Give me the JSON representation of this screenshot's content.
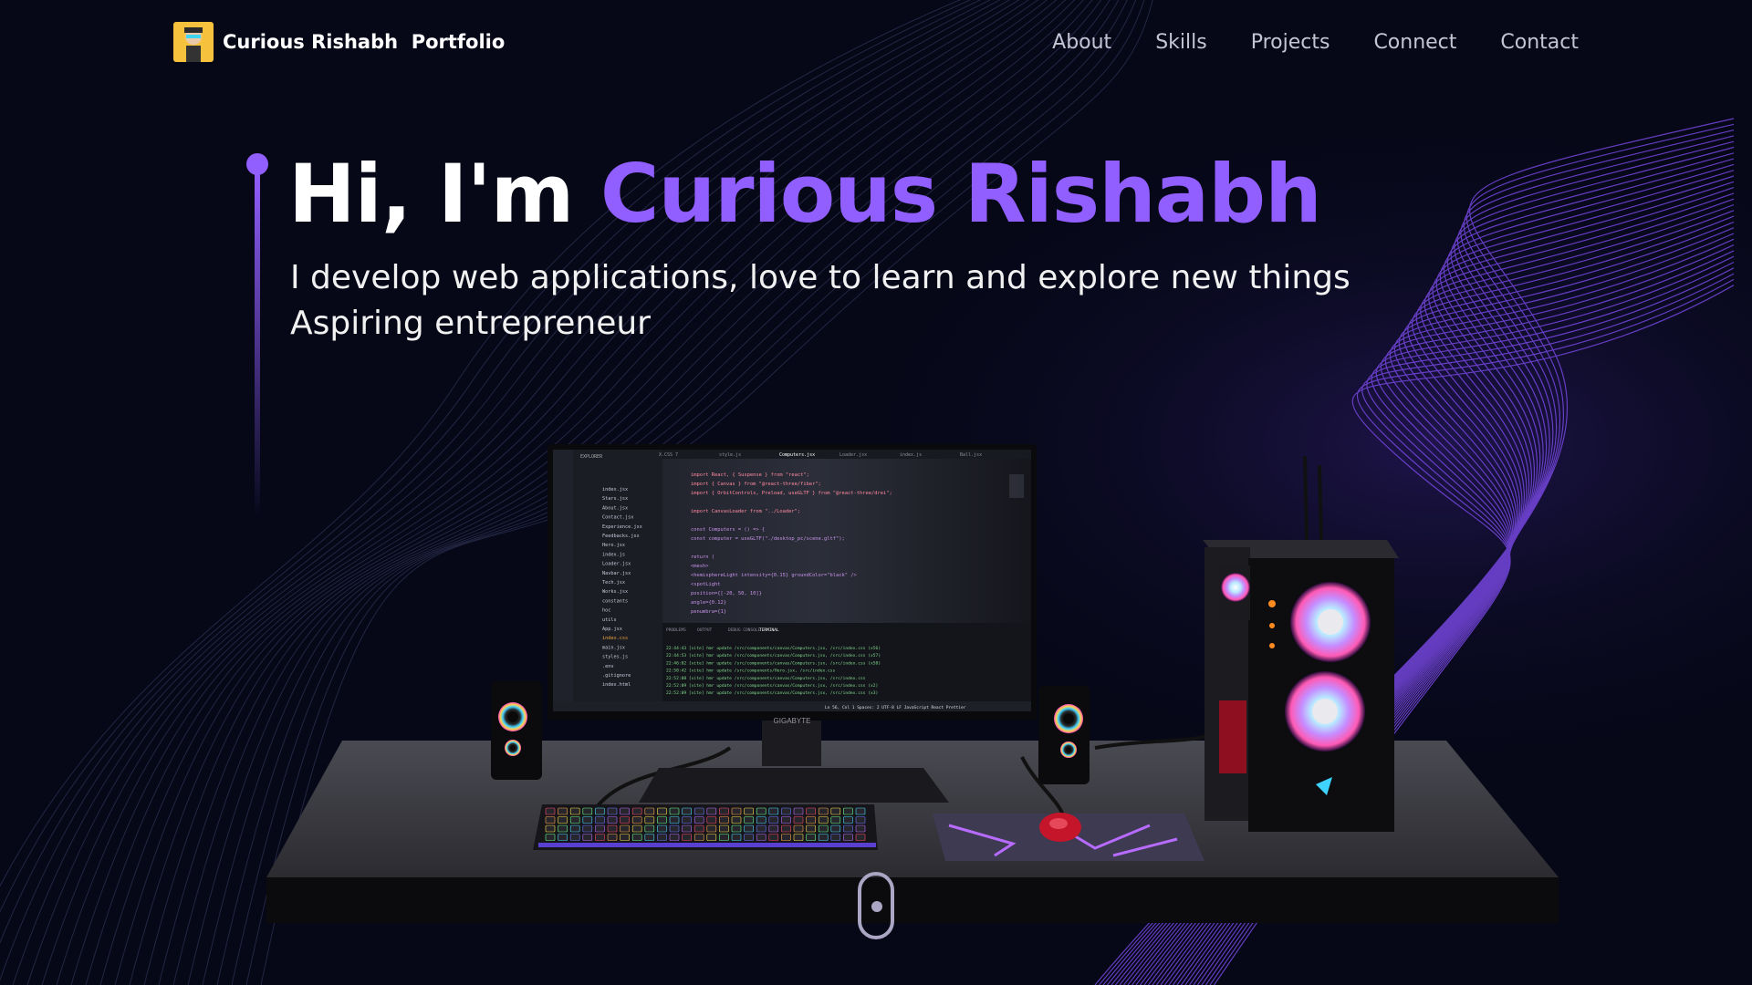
{
  "navbar": {
    "brand_first": "Curious Rishabh",
    "brand_second": "Portfolio",
    "links": [
      {
        "label": "About"
      },
      {
        "label": "Skills"
      },
      {
        "label": "Projects"
      },
      {
        "label": "Connect"
      },
      {
        "label": "Contact"
      }
    ]
  },
  "hero": {
    "greeting": "Hi, I'm ",
    "name": "Curious Rishabh",
    "subtitle_line1": "I develop web applications, love to learn and explore new things",
    "subtitle_line2": "Aspiring entrepreneur"
  },
  "monitor": {
    "brand": "GIGABYTE",
    "tabs": [
      "X.CSS 7",
      "style.js",
      "Computers.jsx",
      "Loader.jsx",
      "index.js",
      "Ball.jsx"
    ],
    "code_lines": [
      "import React, { Suspense } from \"react\";",
      "import { Canvas } from \"@react-three/fiber\";",
      "import { OrbitControls, Preload, useGLTF } from \"@react-three/drei\";",
      "",
      "import CanvasLoader from \"../Loader\";",
      "",
      "const Computers = () => {",
      "  const computer = useGLTF(\"./desktop_pc/scene.gltf\");",
      "",
      "  return (",
      "    <mesh>",
      "      <hemisphereLight intensity={0.15} groundColor=\"black\" />",
      "      <spotLight",
      "        position={[-20, 50, 10]}",
      "        angle={0.12}",
      "        penumbra={1}"
    ],
    "terminal_lines": [
      "22:44:43 [vite] hmr update /src/components/canvas/Computers.jsx, /src/index.css (x56)",
      "22:44:53 [vite] hmr update /src/components/canvas/Computers.jsx, /src/index.css (x57)",
      "22:46:02 [vite] hmr update /src/components/canvas/Computers.jsx, /src/index.css (x58)",
      "22:50:42 [vite] hmr update /src/components/Hero.jsx, /src/index.css",
      "22:52:08 [vite] hmr update /src/components/canvas/Computers.jsx, /src/index.css",
      "22:52:09 [vite] hmr update /src/components/canvas/Computers.jsx, /src/index.css (x2)",
      "22:52:09 [vite] hmr update /src/components/canvas/Computers.jsx, /src/index.css (x3)"
    ],
    "files": [
      "index.jsx",
      "Stars.jsx",
      "About.jsx",
      "Contact.jsx",
      "Experience.jsx",
      "Feedbacks.jsx",
      "Hero.jsx",
      "index.js",
      "Loader.jsx",
      "Navbar.jsx",
      "Tech.jsx",
      "Works.jsx",
      "constants",
      "hoc",
      "utils",
      "App.jsx",
      "index.css",
      "main.jsx",
      "styles.js",
      ".env",
      ".gitignore",
      "index.html"
    ],
    "panel_tabs": [
      "PROBLEMS",
      "OUTPUT",
      "DEBUG CONSOLE",
      "TERMINAL"
    ],
    "explorer_label": "EXPLORER",
    "status_bar": "Ln 56, Col 1   Spaces: 2   UTF-8   LF   JavaScript React   Prettier"
  },
  "colors": {
    "background": "#060818",
    "accent": "#915eff",
    "nav_text": "#c4c4d4"
  }
}
